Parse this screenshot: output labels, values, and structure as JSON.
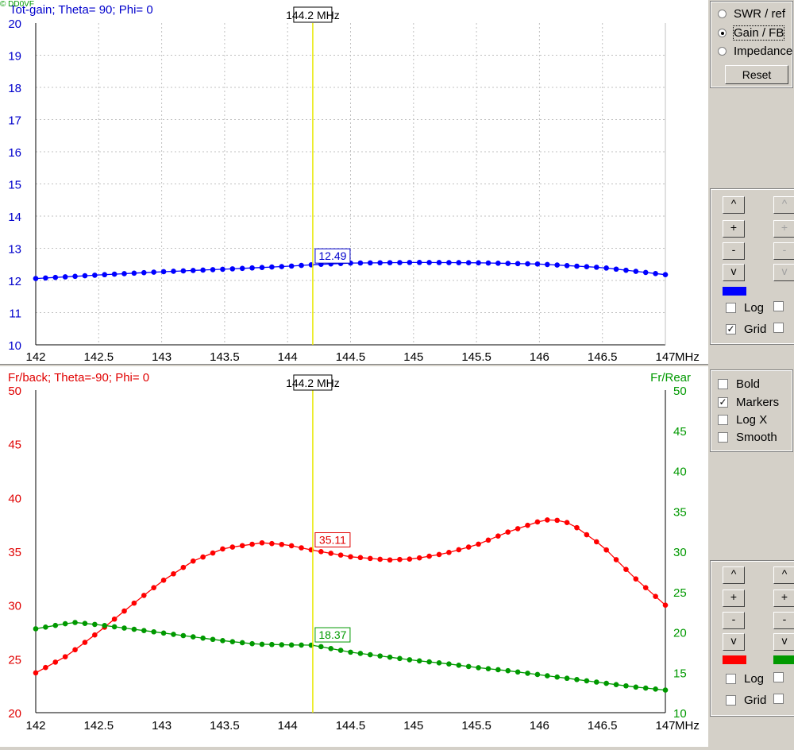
{
  "watermark": "© DD0VF",
  "controls": {
    "radios": [
      {
        "label": "SWR / ref",
        "selected": false
      },
      {
        "label": "Gain / FB",
        "selected": true
      },
      {
        "label": "Impedance",
        "selected": false
      }
    ],
    "reset_label": "Reset",
    "top_buttons": {
      "up": "^",
      "plus": "+",
      "minus": "-",
      "down": "v"
    },
    "top_color": "#0000ff",
    "top_checks": [
      {
        "label": "Log",
        "checked": false
      },
      {
        "label": "Grid",
        "checked": true
      }
    ],
    "options": [
      {
        "label": "Bold",
        "checked": false
      },
      {
        "label": "Markers",
        "checked": true
      },
      {
        "label": "Log X",
        "checked": false
      },
      {
        "label": "Smooth",
        "checked": false
      }
    ],
    "bottom_buttons": {
      "up": "^",
      "plus": "+",
      "minus": "-",
      "down": "v"
    },
    "bottom_colors": [
      "#ff0000",
      "#009900"
    ],
    "bottom_checks": [
      {
        "label": "Log",
        "checked": false
      },
      {
        "label": "Grid",
        "checked": false
      }
    ]
  },
  "chart_data": [
    {
      "type": "line",
      "title": "Tot-gain; Theta= 90; Phi= 0",
      "x_unit": "MHz",
      "xlim": [
        142,
        147
      ],
      "ylim": [
        10,
        20
      ],
      "x_ticks": [
        "142",
        "142.5",
        "143",
        "143.5",
        "144",
        "144.5",
        "145",
        "145.5",
        "146",
        "146.5",
        "147"
      ],
      "y_ticks": [
        "20",
        "19",
        "18",
        "17",
        "16",
        "15",
        "14",
        "13",
        "12",
        "11",
        "10"
      ],
      "grid": true,
      "marker": {
        "x": 144.2,
        "label": "144.2 MHz",
        "value_label": "12.49"
      },
      "series": [
        {
          "color": "#0000ff",
          "x": [
            142,
            142.5,
            143,
            143.5,
            144,
            144.2,
            144.5,
            145,
            145.5,
            146,
            146.5,
            147
          ],
          "y": [
            12.06,
            12.17,
            12.27,
            12.35,
            12.44,
            12.49,
            12.54,
            12.56,
            12.55,
            12.51,
            12.4,
            12.18
          ]
        }
      ]
    },
    {
      "type": "line",
      "title": "Fr/back; Theta=-90; Phi= 0",
      "right_title": "Fr/Rear",
      "x_unit": "MHz",
      "xlim": [
        142,
        147
      ],
      "ylim": [
        20,
        50
      ],
      "y2lim": [
        10,
        50
      ],
      "x_ticks": [
        "142",
        "142.5",
        "143",
        "143.5",
        "144",
        "144.5",
        "145",
        "145.5",
        "146",
        "146.5",
        "147"
      ],
      "y_ticks": [
        "50",
        "45",
        "40",
        "35",
        "30",
        "25",
        "20"
      ],
      "y2_ticks": [
        "50",
        "45",
        "40",
        "35",
        "30",
        "25",
        "20",
        "15",
        "10"
      ],
      "grid": false,
      "marker": {
        "x": 144.2,
        "label": "144.2 MHz",
        "value_label_1": "35.11",
        "value_label_2": "18.37"
      },
      "series": [
        {
          "color": "#ff0000",
          "axis": "left",
          "x": [
            142,
            142.25,
            142.5,
            142.75,
            143,
            143.25,
            143.5,
            143.8,
            144,
            144.2,
            144.5,
            144.8,
            145,
            145.25,
            145.5,
            145.75,
            146,
            146.1,
            146.25,
            146.5,
            146.75,
            147
          ],
          "y": [
            23.7,
            25.3,
            27.5,
            29.9,
            32.2,
            34.1,
            35.3,
            35.8,
            35.6,
            35.11,
            34.5,
            34.2,
            34.3,
            34.8,
            35.6,
            36.8,
            37.8,
            38.0,
            37.6,
            35.5,
            32.6,
            30.0
          ]
        },
        {
          "color": "#009900",
          "axis": "right",
          "x": [
            142,
            142.3,
            142.5,
            142.75,
            143,
            143.25,
            143.5,
            143.75,
            144,
            144.2,
            144.5,
            144.75,
            145,
            145.25,
            145.5,
            145.75,
            146,
            146.25,
            146.5,
            146.75,
            147
          ],
          "y": [
            20.4,
            21.2,
            20.9,
            20.4,
            19.9,
            19.4,
            18.9,
            18.5,
            18.4,
            18.37,
            17.5,
            17.0,
            16.5,
            16.1,
            15.6,
            15.2,
            14.7,
            14.2,
            13.7,
            13.2,
            12.8
          ]
        }
      ]
    }
  ]
}
